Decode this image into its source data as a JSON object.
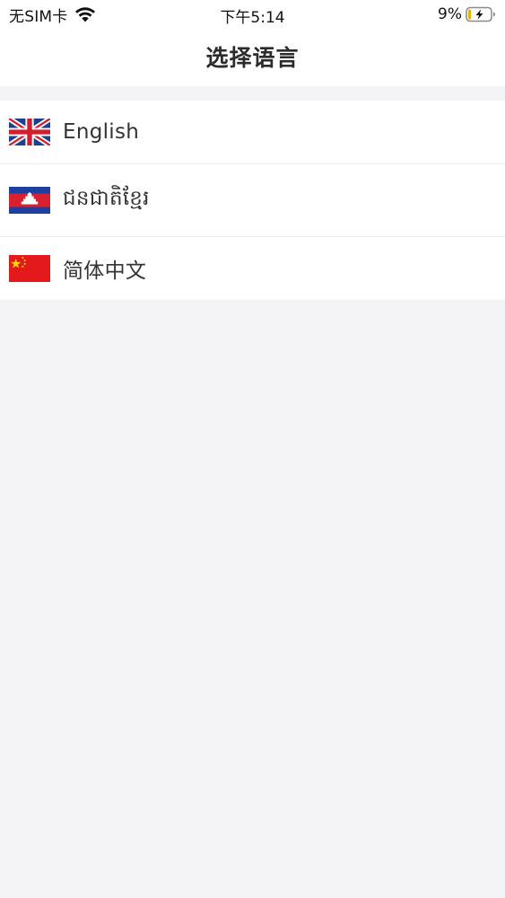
{
  "status_bar": {
    "carrier": "无SIM卡",
    "time": "下午5:14",
    "battery_percent": "9%",
    "wifi_icon": "wifi-icon",
    "battery_icon": "battery-charging-icon"
  },
  "nav": {
    "title": "选择语言"
  },
  "languages": [
    {
      "label": "English",
      "flag_icon": "uk-flag-icon"
    },
    {
      "label": "ជនជាតិខ្មែរ",
      "flag_icon": "cambodia-flag-icon"
    },
    {
      "label": "简体中文",
      "flag_icon": "china-flag-icon"
    }
  ],
  "colors": {
    "background": "#f4f3f5",
    "surface": "#ffffff",
    "text": "#333333",
    "divider": "#ececec"
  }
}
